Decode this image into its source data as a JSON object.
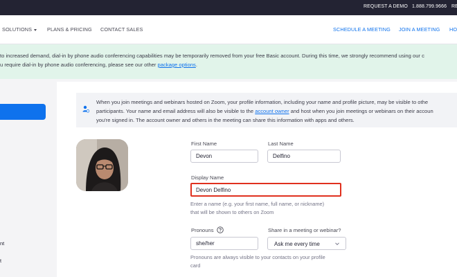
{
  "topbar": {
    "request_demo": "REQUEST A DEMO",
    "phone": "1.888.799.9666",
    "resources": "RE"
  },
  "nav": {
    "solutions": "SOLUTIONS",
    "plans_pricing": "PLANS & PRICING",
    "contact_sales": "CONTACT SALES",
    "schedule": "SCHEDULE A MEETING",
    "join": "JOIN A MEETING",
    "host": "HO"
  },
  "notice": {
    "line1": "to increased demand, dial-in by phone audio conferencing capabilities may be temporarily removed from your free Basic account. During this time, we strongly recommend using our c",
    "line2_prefix": "u require dial-in by phone audio conferencing, please see our other ",
    "line2_link": "package options",
    "line2_suffix": "."
  },
  "sidebar": {
    "items": [
      {
        "label": "nt"
      },
      {
        "label": "t"
      }
    ]
  },
  "info": {
    "line1": "When you join meetings and webinars hosted on Zoom, your profile information, including your name and profile picture, may be visible to othe",
    "line2_prefix": "participants. Your name and email address will also be visible to the ",
    "line2_link": "account owner",
    "line2_suffix": " and host when you join meetings or webinars on their accoun",
    "line3": "you're signed in. The account owner and others in the meeting can share this information with apps and others."
  },
  "profile": {
    "first_name_label": "First Name",
    "first_name_value": "Devon",
    "last_name_label": "Last Name",
    "last_name_value": "Delfino",
    "display_name_label": "Display Name",
    "display_name_value": "Devon Delfino",
    "display_hint_line1": "Enter a name (e.g. your first name, full name, or nickname)",
    "display_hint_line2": "that will be shown to others on Zoom",
    "pronouns_label": "Pronouns",
    "pronouns_value": "she/her",
    "share_label": "Share in a meeting or webinar?",
    "share_value": "Ask me every time",
    "pronouns_hint_line1": "Pronouns are always visible to your contacts on your profile",
    "pronouns_hint_line2": "card"
  },
  "colors": {
    "accent": "#0e72ed",
    "highlight": "#e0301e",
    "notice_bg": "#e1f4ea",
    "topbar_bg": "#232333"
  }
}
